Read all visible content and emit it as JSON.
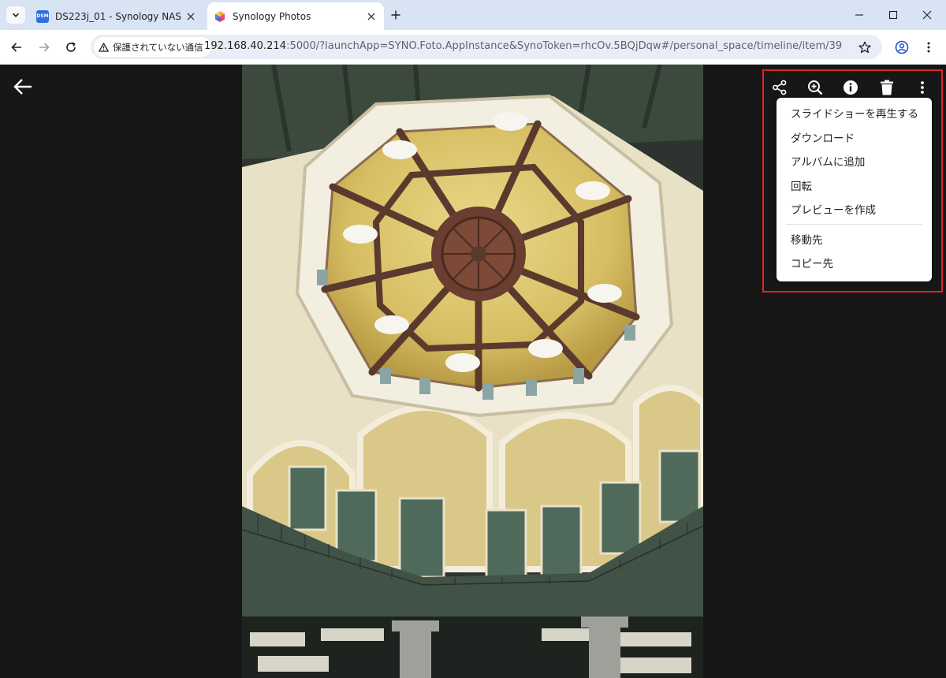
{
  "browser": {
    "tabs": [
      {
        "title": "DS223j_01 - Synology NAS",
        "favicon_text": "DSM",
        "active": false
      },
      {
        "title": "Synology Photos",
        "active": true
      }
    ],
    "security_label": "保護されていない通信",
    "url_host": "192.168.40.214",
    "url_rest": ":5000/?launchApp=SYNO.Foto.AppInstance&SynoToken=rhcOv.5BQjDqw#/personal_space/timeline/item/39"
  },
  "viewer": {
    "toolbar_icons": [
      "share-icon",
      "zoom-in-icon",
      "info-icon",
      "delete-icon",
      "more-vertical-icon"
    ],
    "menu": {
      "group1": [
        "スライドショーを再生する",
        "ダウンロード",
        "アルバムに追加",
        "回転",
        "プレビューを作成"
      ],
      "group2": [
        "移動先",
        "コピー先"
      ]
    }
  },
  "colors": {
    "highlight": "#e0232b",
    "tabstrip": "#d8e3f3",
    "viewer_background": "#171717"
  }
}
